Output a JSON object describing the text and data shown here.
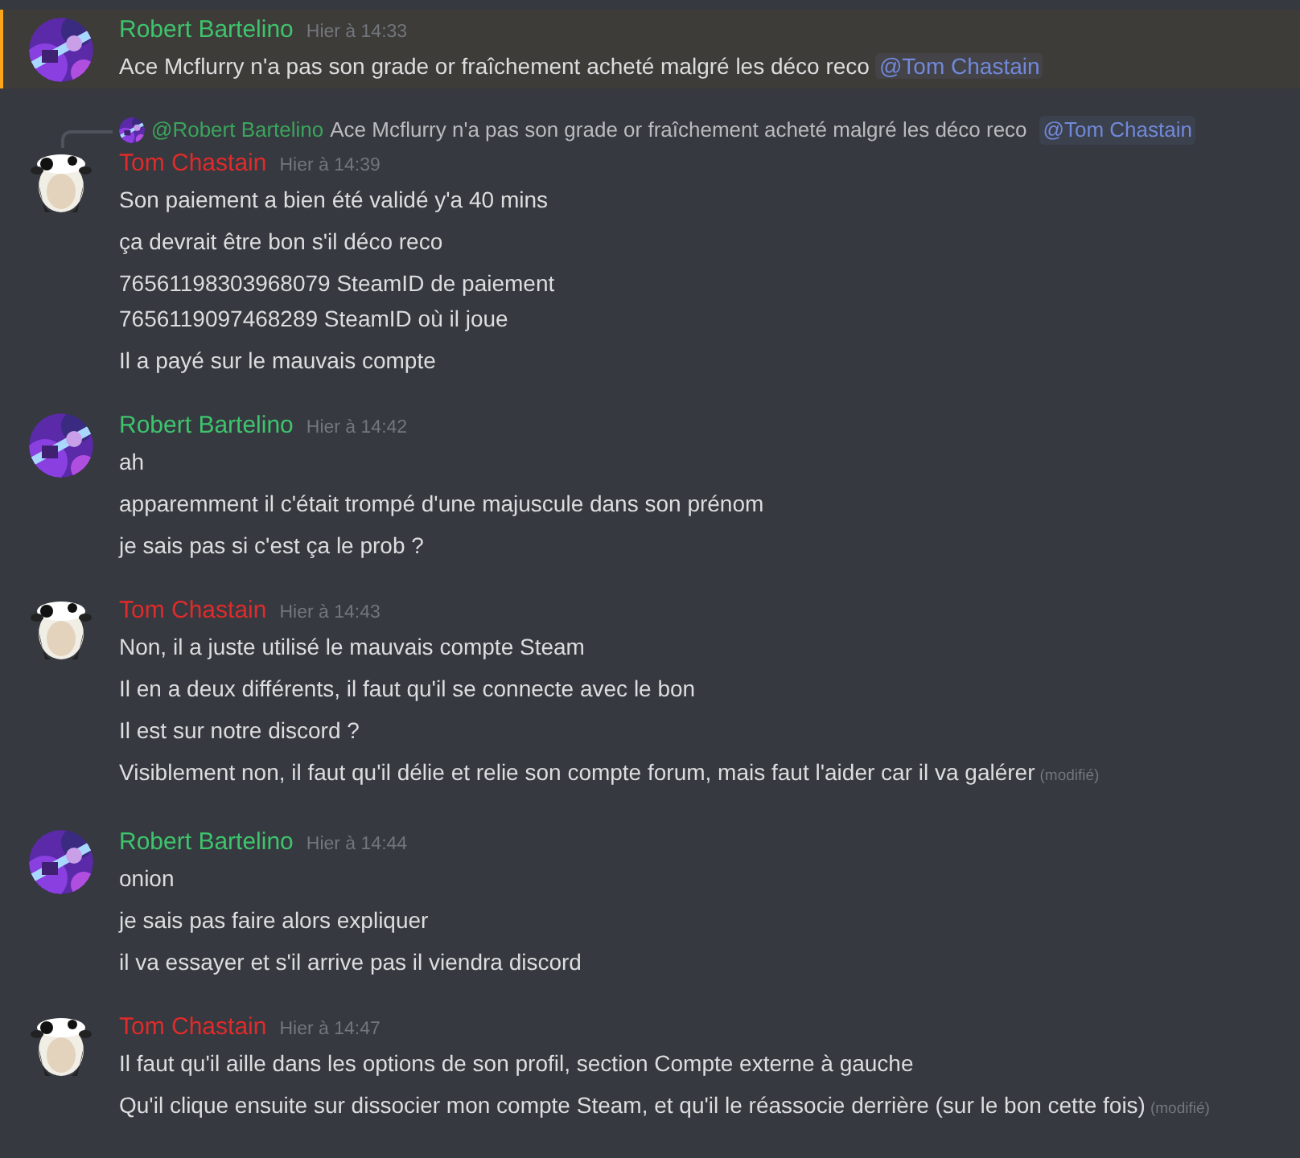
{
  "messages": [
    {
      "author": "Robert Bartelino",
      "color": "#3ec46d",
      "time": "Hier à 14:33",
      "highlighted": true,
      "avatar": {
        "kind": "photo"
      },
      "lines": [
        {
          "text": "Ace Mcflurry n'a pas son grade or fraîchement acheté malgré les déco reco",
          "mention": "@Tom Chastain"
        }
      ]
    },
    {
      "author": "Tom Chastain",
      "color": "#e02b2b",
      "time": "Hier à 14:39",
      "highlighted": false,
      "avatar": {
        "kind": "spotted"
      },
      "reply": {
        "author": "@Robert Bartelino",
        "avatar": {
          "kind": "photo"
        },
        "text": "Ace Mcflurry n'a pas son grade or fraîchement acheté malgré les déco reco",
        "mention": "@Tom Chastain"
      },
      "lines": [
        {
          "text": "Son paiement a bien été validé y'a 40 mins"
        },
        {
          "text": "ça devrait être bon s'il déco reco"
        },
        {
          "text": "76561198303968079 SteamID de paiement\n7656119097468289 SteamID où il joue"
        },
        {
          "text": "Il a payé sur le mauvais compte"
        }
      ]
    },
    {
      "author": "Robert Bartelino",
      "color": "#3ec46d",
      "time": "Hier à 14:42",
      "highlighted": false,
      "avatar": {
        "kind": "photo"
      },
      "lines": [
        {
          "text": "ah"
        },
        {
          "text": "apparemment il c'était trompé d'une majuscule dans son prénom"
        },
        {
          "text": "je sais pas si c'est ça le prob ?"
        }
      ]
    },
    {
      "author": "Tom Chastain",
      "color": "#e02b2b",
      "time": "Hier à 14:43",
      "highlighted": false,
      "avatar": {
        "kind": "spotted"
      },
      "lines": [
        {
          "text": "Non, il a juste utilisé le mauvais compte Steam"
        },
        {
          "text": "Il en a deux différents, il faut qu'il se connecte avec le bon"
        },
        {
          "text": "Il est sur notre discord ?"
        },
        {
          "text": "Visiblement non, il faut qu'il délie et relie son compte forum, mais faut l'aider car il va galérer",
          "edited": "(modifié)"
        }
      ]
    },
    {
      "author": "Robert Bartelino",
      "color": "#3ec46d",
      "time": "Hier à 14:44",
      "highlighted": false,
      "avatar": {
        "kind": "photo"
      },
      "lines": [
        {
          "text": "onion"
        },
        {
          "text": "je sais pas faire alors expliquer"
        },
        {
          "text": "il va essayer et s'il arrive pas il viendra discord"
        }
      ]
    },
    {
      "author": "Tom Chastain",
      "color": "#e02b2b",
      "time": "Hier à 14:47",
      "highlighted": false,
      "avatar": {
        "kind": "spotted"
      },
      "lines": [
        {
          "text": "Il faut qu'il aille dans les options de son profil, section Compte externe à gauche"
        },
        {
          "text": "Qu'il clique ensuite sur dissocier mon compte Steam, et qu'il le réassocie derrière (sur le bon cette fois)",
          "edited": "(modifié)"
        }
      ]
    }
  ]
}
